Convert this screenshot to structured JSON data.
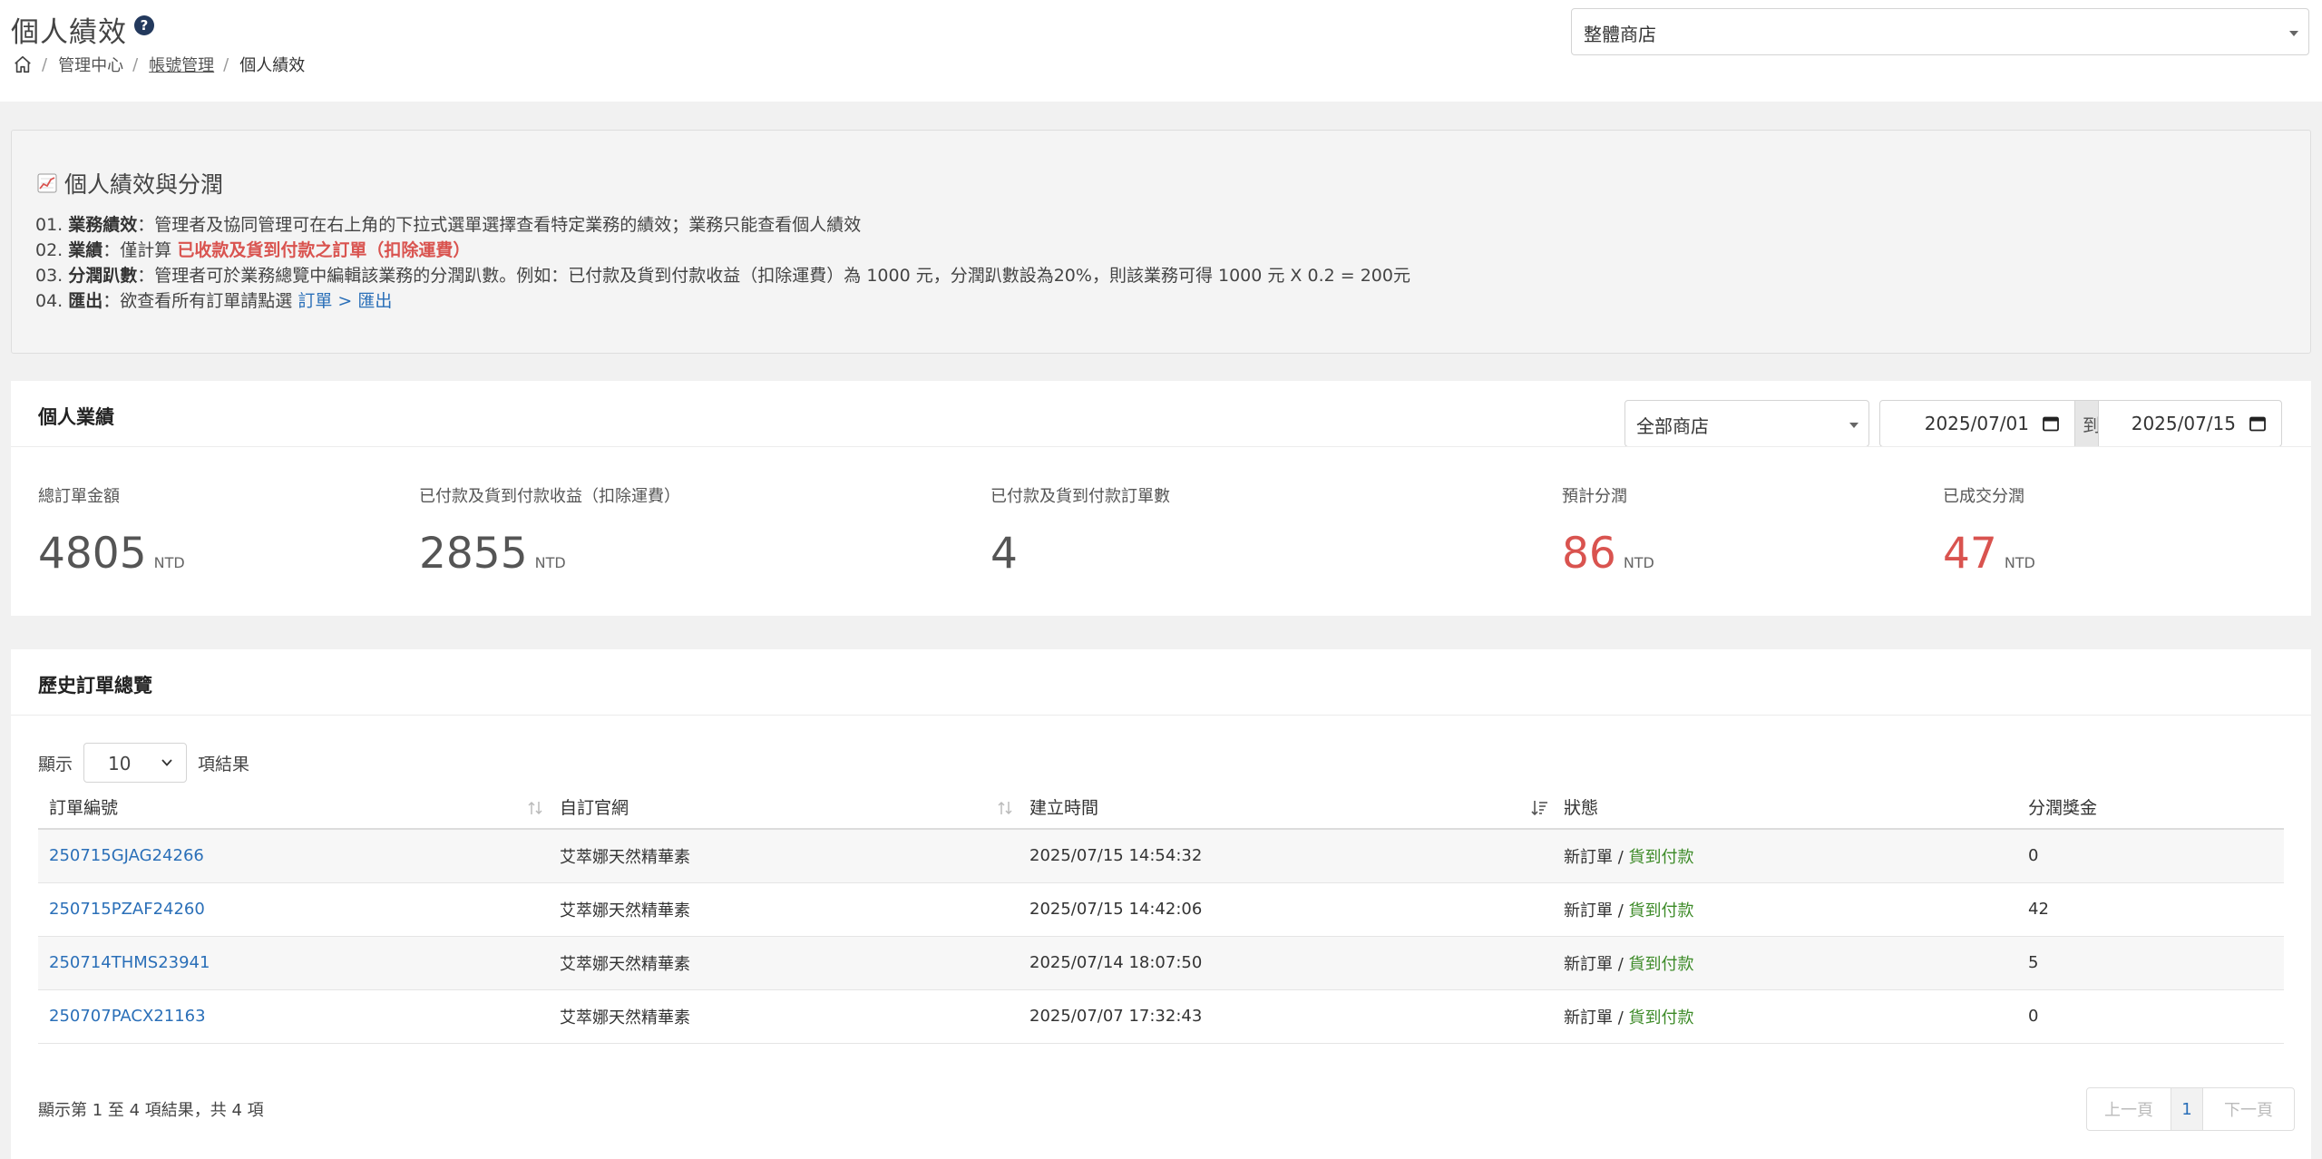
{
  "header": {
    "title": "個人績效",
    "help_icon": "?",
    "breadcrumb": [
      "管理中心",
      "帳號管理",
      "個人績效"
    ],
    "store_select": "整體商店"
  },
  "info": {
    "title": "個人績效與分潤",
    "lines": [
      {
        "prefix": "01. ",
        "key": "業務績效",
        "text": "：管理者及協同管理可在右上角的下拉式選單選擇查看特定業務的績效；業務只能查看個人績效"
      },
      {
        "prefix": "02. ",
        "key": "業績",
        "text": "：僅計算 ",
        "highlight": "已收款及貨到付款之訂單（扣除運費）"
      },
      {
        "prefix": "03. ",
        "key": "分潤趴數",
        "text": "：管理者可於業務總覽中編輯該業務的分潤趴數。例如：已付款及貨到付款收益（扣除運費）為 1000 元，分潤趴數設為20%，則該業務可得 1000 元 X 0.2 = 200元"
      },
      {
        "prefix": "04. ",
        "key": "匯出",
        "text": "：欲查看所有訂單請點選 ",
        "link": "訂單 > 匯出"
      }
    ]
  },
  "performance": {
    "title": "個人業績",
    "store_filter": "全部商店",
    "date_from": "2025/07/01",
    "date_sep": "到",
    "date_to": "2025/07/15",
    "stats": [
      {
        "label": "總訂單金額",
        "value": "4805",
        "unit": "NTD"
      },
      {
        "label": "已付款及貨到付款收益（扣除運費）",
        "value": "2855",
        "unit": "NTD"
      },
      {
        "label": "已付款及貨到付款訂單數",
        "value": "4",
        "unit": ""
      },
      {
        "label": "預計分潤",
        "value": "86",
        "unit": "NTD"
      },
      {
        "label": "已成交分潤",
        "value": "47",
        "unit": "NTD"
      }
    ]
  },
  "history": {
    "title": "歷史訂單總覽",
    "show_label": "顯示",
    "page_length": "10",
    "results_label": "項結果",
    "columns": [
      "訂單編號",
      "自訂官網",
      "建立時間",
      "狀態",
      "分潤獎金"
    ],
    "rows": [
      {
        "id": "250715GJAG24266",
        "site": "艾萃娜天然精華素",
        "time": "2025/07/15 14:54:32",
        "status": "新訂單",
        "payment": "貨到付款",
        "bonus": "0"
      },
      {
        "id": "250715PZAF24260",
        "site": "艾萃娜天然精華素",
        "time": "2025/07/15 14:42:06",
        "status": "新訂單",
        "payment": "貨到付款",
        "bonus": "42"
      },
      {
        "id": "250714THMS23941",
        "site": "艾萃娜天然精華素",
        "time": "2025/07/14 18:07:50",
        "status": "新訂單",
        "payment": "貨到付款",
        "bonus": "5"
      },
      {
        "id": "250707PACX21163",
        "site": "艾萃娜天然精華素",
        "time": "2025/07/07 17:32:43",
        "status": "新訂單",
        "payment": "貨到付款",
        "bonus": "0"
      }
    ],
    "status_sep": " / ",
    "footer": "顯示第 1 至 4 項結果，共 4 項",
    "pager": {
      "prev": "上一頁",
      "current": "1",
      "next": "下一頁"
    }
  }
}
